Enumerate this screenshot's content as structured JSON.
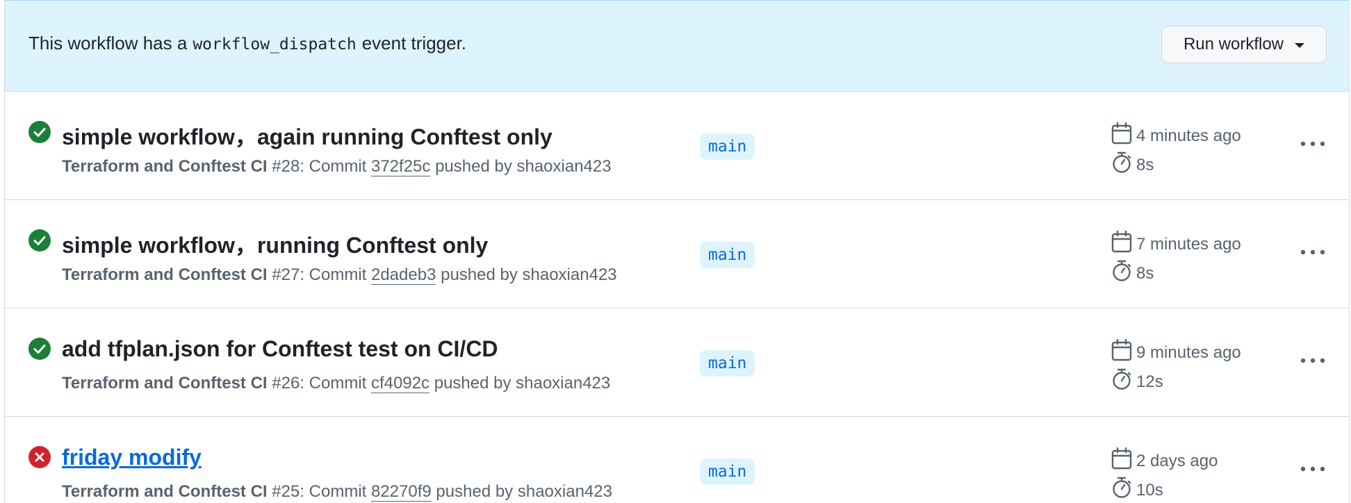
{
  "banner": {
    "text_before": "This workflow has a",
    "code": "workflow_dispatch",
    "text_after": "event trigger.",
    "button_label": "Run workflow"
  },
  "colors": {
    "success": "#1a7f37",
    "failure": "#cf222e",
    "accent": "#0969da",
    "banner_bg": "#ddf4ff"
  },
  "runs": [
    {
      "status": "success",
      "title": "simple workflow，again running Conftest only",
      "workflow": "Terraform and Conftest CI",
      "run_number": "#28",
      "commit_label": ": Commit",
      "sha": "372f25c",
      "pushed_by": "pushed by shaoxian423",
      "branch": "main",
      "time": "4 minutes ago",
      "duration": "8s"
    },
    {
      "status": "success",
      "title": "simple workflow，running Conftest only",
      "workflow": "Terraform and Conftest CI",
      "run_number": "#27",
      "commit_label": ": Commit",
      "sha": "2dadeb3",
      "pushed_by": "pushed by shaoxian423",
      "branch": "main",
      "time": "7 minutes ago",
      "duration": "8s"
    },
    {
      "status": "success",
      "title": "add tfplan.json for Conftest test on CI/CD",
      "workflow": "Terraform and Conftest CI",
      "run_number": "#26",
      "commit_label": ": Commit",
      "sha": "cf4092c",
      "pushed_by": "pushed by shaoxian423",
      "branch": "main",
      "time": "9 minutes ago",
      "duration": "12s"
    },
    {
      "status": "failure",
      "title": "friday modify",
      "workflow": "Terraform and Conftest CI",
      "run_number": "#25",
      "commit_label": ": Commit",
      "sha": "82270f9",
      "pushed_by": "pushed by shaoxian423",
      "branch": "main",
      "time": "2 days ago",
      "duration": "10s"
    }
  ]
}
